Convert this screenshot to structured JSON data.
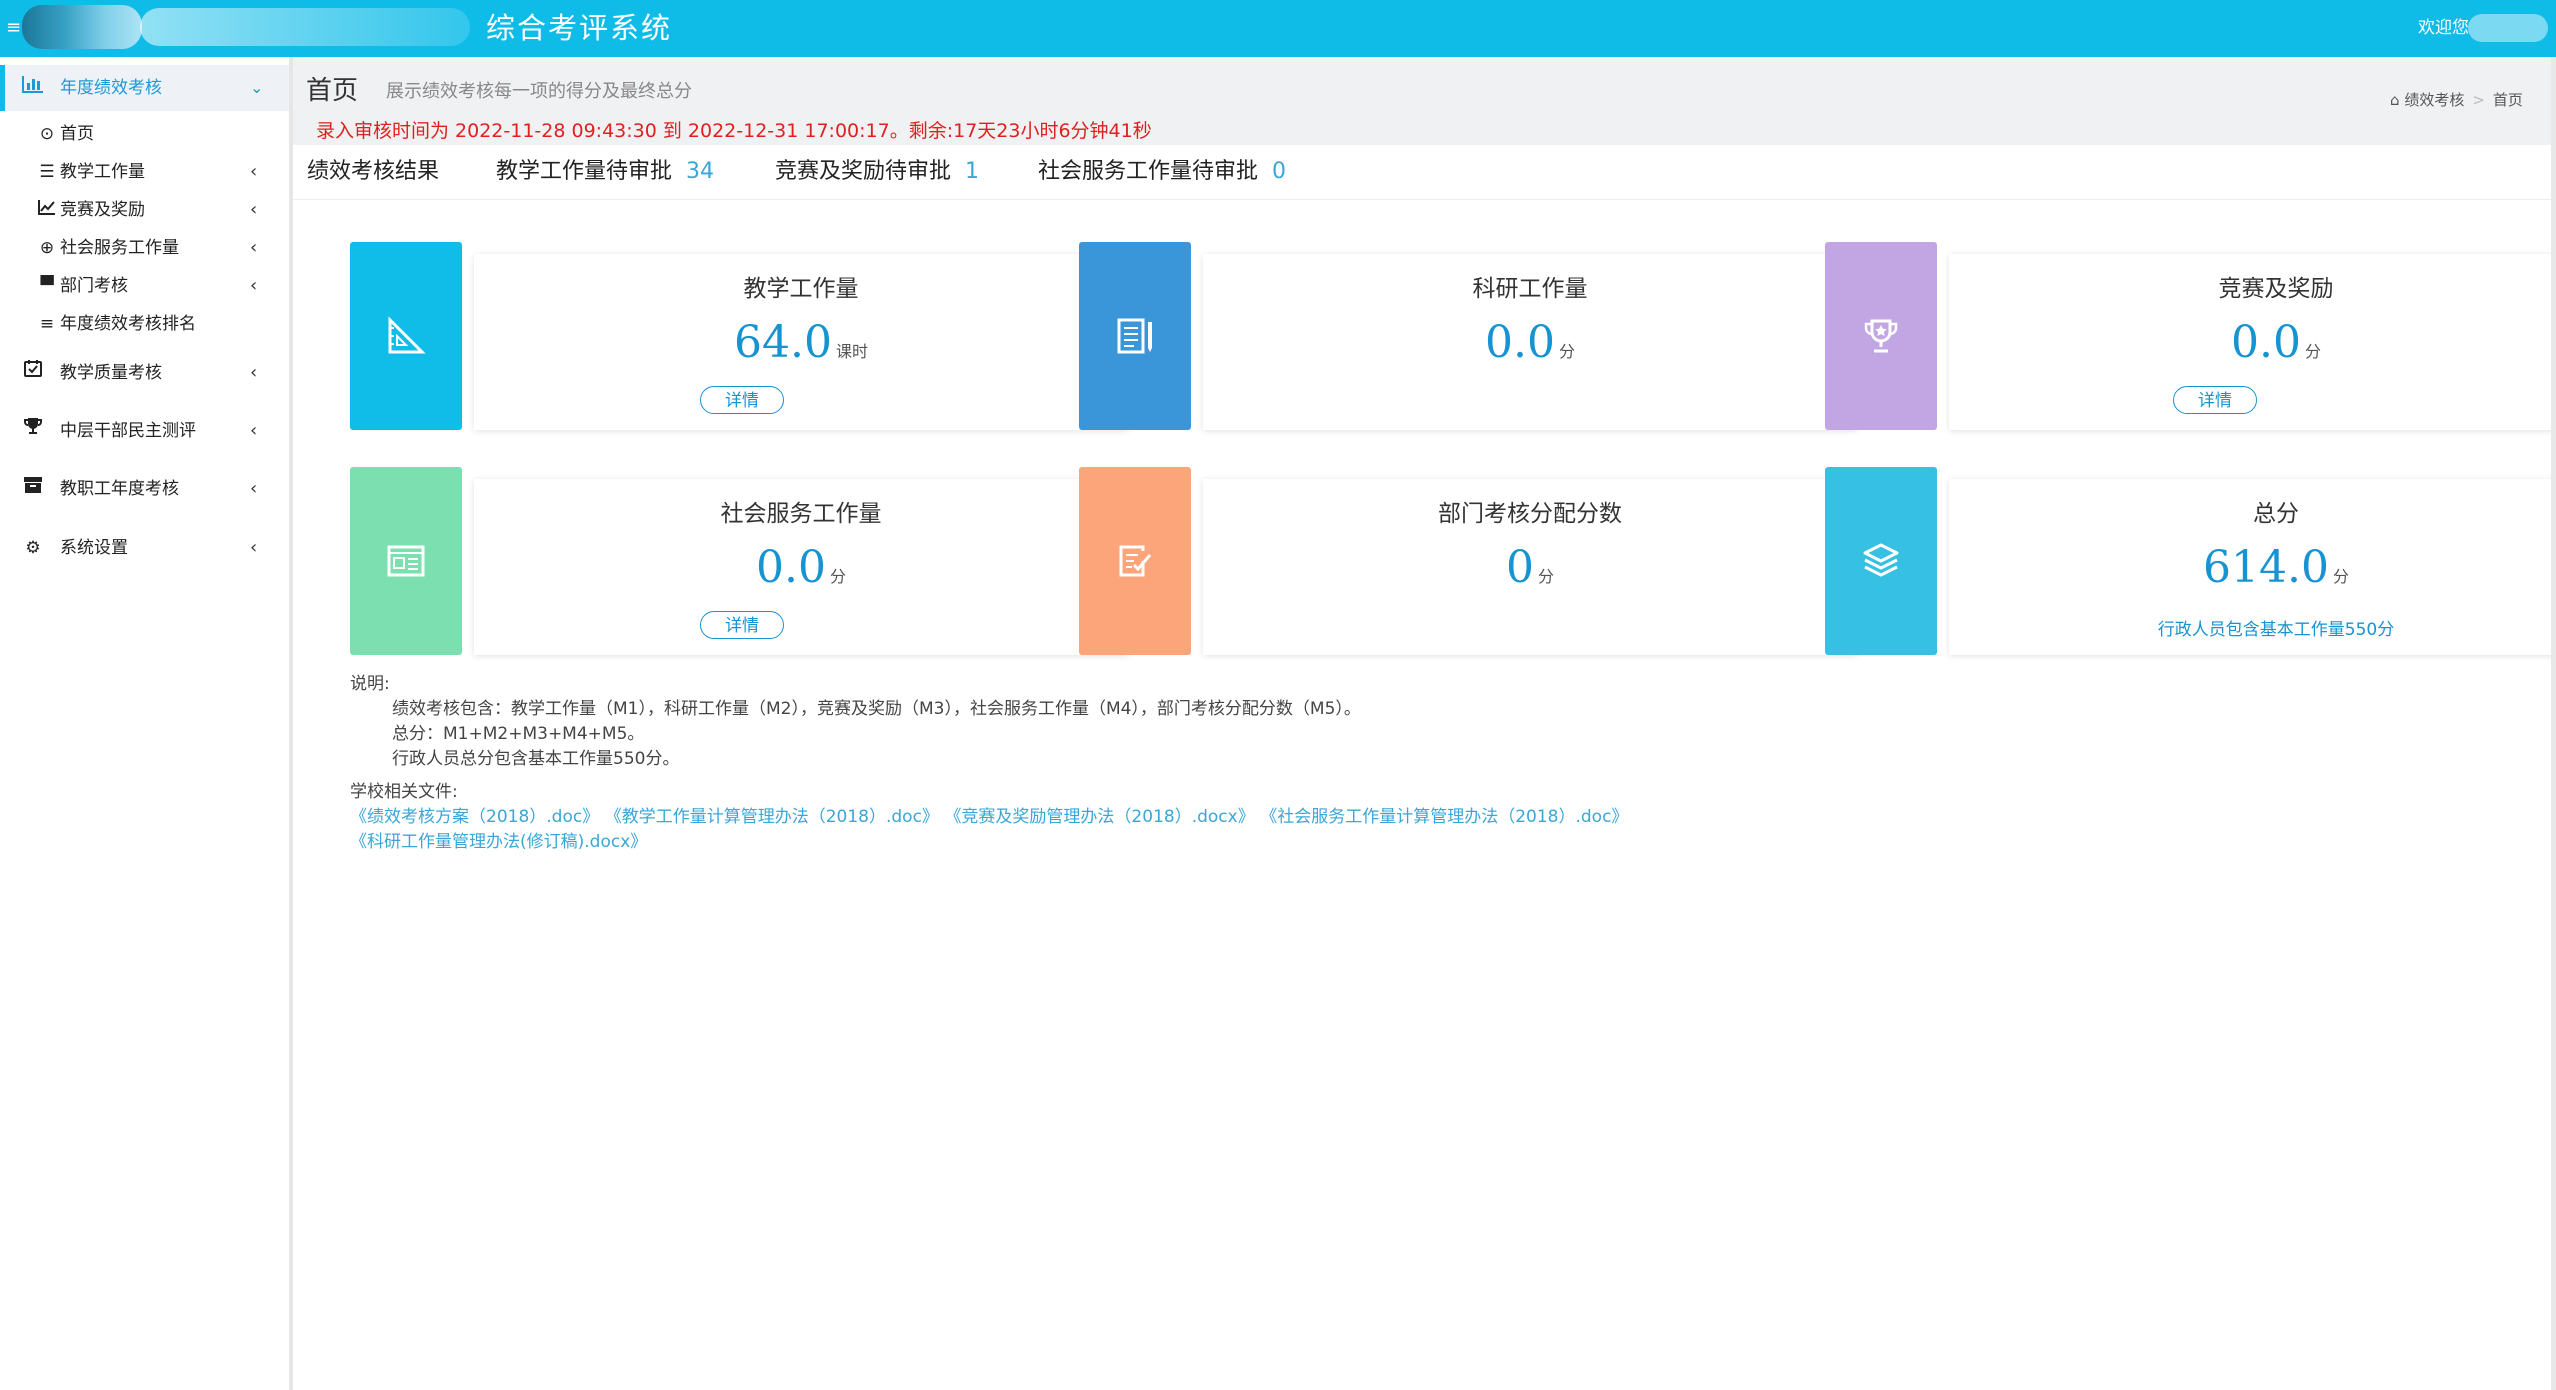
{
  "header": {
    "app_title": "综合考评系统",
    "welcome": "欢迎您",
    "accent_color": "#0fbce8"
  },
  "sidebar": {
    "items": [
      {
        "label": "年度绩效考核",
        "icon": "bar-chart-icon",
        "active": true
      },
      {
        "label": "首页",
        "icon": "circle-dot-icon"
      },
      {
        "label": "教学工作量",
        "icon": "list-icon"
      },
      {
        "label": "竞赛及奖励",
        "icon": "line-chart-icon"
      },
      {
        "label": "社会服务工作量",
        "icon": "globe-icon"
      },
      {
        "label": "部门考核",
        "icon": "archive-icon"
      },
      {
        "label": "年度绩效考核排名",
        "icon": "bars-icon"
      },
      {
        "label": "教学质量考核",
        "icon": "calendar-check-icon"
      },
      {
        "label": "中层干部民主测评",
        "icon": "trophy-icon"
      },
      {
        "label": "教职工年度考核",
        "icon": "archive-icon"
      },
      {
        "label": "系统设置",
        "icon": "gear-icon"
      }
    ]
  },
  "page": {
    "title": "首页",
    "subtitle": "展示绩效考核每一项的得分及最终总分",
    "notice": "录入审核时间为 2022-11-28 09:43:30 到 2022-12-31 17:00:17。剩余:17天23小时6分钟41秒",
    "breadcrumb": {
      "home": "绩效考核",
      "current": "首页"
    }
  },
  "tabs": [
    {
      "label": "绩效考核结果",
      "count": ""
    },
    {
      "label": "教学工作量待审批",
      "count": "34"
    },
    {
      "label": "竞赛及奖励待审批",
      "count": "1"
    },
    {
      "label": "社会服务工作量待审批",
      "count": "0"
    }
  ],
  "cards": [
    {
      "title": "教学工作量",
      "value": "64.0",
      "unit": "课时",
      "button": "详情",
      "color": "#10bde9",
      "icon": "ruler-triangle-icon"
    },
    {
      "title": "科研工作量",
      "value": "0.0",
      "unit": "分",
      "color": "#3a95d9",
      "icon": "document-pencil-icon"
    },
    {
      "title": "竞赛及奖励",
      "value": "0.0",
      "unit": "分",
      "button": "详情",
      "color": "#c1a6e3",
      "icon": "trophy-icon"
    },
    {
      "title": "社会服务工作量",
      "value": "0.0",
      "unit": "分",
      "button": "详情",
      "color": "#7cdfb0",
      "icon": "newspaper-icon"
    },
    {
      "title": "部门考核分配分数",
      "value": "0",
      "unit": "分",
      "color": "#fca57b",
      "icon": "clipboard-check-icon"
    },
    {
      "title": "总分",
      "value": "614.0",
      "unit": "分",
      "note": "行政人员包含基本工作量550分",
      "color": "#36c0e3",
      "icon": "layers-icon"
    }
  ],
  "notes": {
    "heading": "说明:",
    "lines": [
      "绩效考核包含：教学工作量（M1），科研工作量（M2），竞赛及奖励（M3），社会服务工作量（M4），部门考核分配分数（M5）。",
      "总分：M1+M2+M3+M4+M5。",
      "行政人员总分包含基本工作量550分。"
    ]
  },
  "files": {
    "heading": "学校相关文件:",
    "links": [
      "《绩效考核方案（2018）.doc》",
      "《教学工作量计算管理办法（2018）.doc》",
      "《竞赛及奖励管理办法（2018）.docx》",
      "《社会服务工作量计算管理办法（2018）.doc》",
      "《科研工作量管理办法(修订稿).docx》"
    ]
  }
}
